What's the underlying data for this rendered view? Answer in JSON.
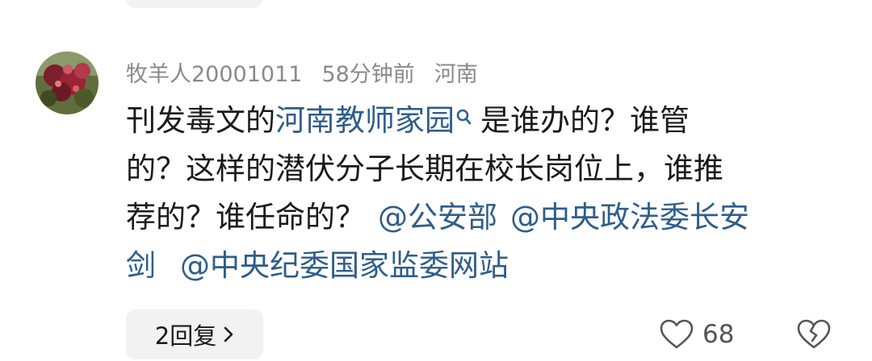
{
  "comment": {
    "author": "牧羊人20001011",
    "time": "58分钟前",
    "location": "河南",
    "text": {
      "l1_pre": "刊发毒文的",
      "l1_link": "河南教师家园",
      "l1_post": "是谁办的？谁管",
      "l2": "的？这样的潜伏分子长期在校长岗位上，谁推",
      "l3_pre": "荐的？谁任命的？",
      "l3_mention1": "@公安部",
      "l3_mention2": "@中央政法委长安",
      "l4_mention2_cont": "剑",
      "l4_mention3": "@中央纪委国家监委网站"
    }
  },
  "actions": {
    "reply_label": "2回复",
    "like_count": "68"
  },
  "icons": {
    "search_mark": "search-mark-icon",
    "reply_chevron": "chevron-right-icon",
    "like": "heart-outline-icon",
    "dislike": "broken-heart-icon"
  },
  "colors": {
    "link": "#2f5d8a",
    "meta": "#8a8a8a",
    "text": "#1a1a1a",
    "chip_bg": "#f2f2f2"
  }
}
